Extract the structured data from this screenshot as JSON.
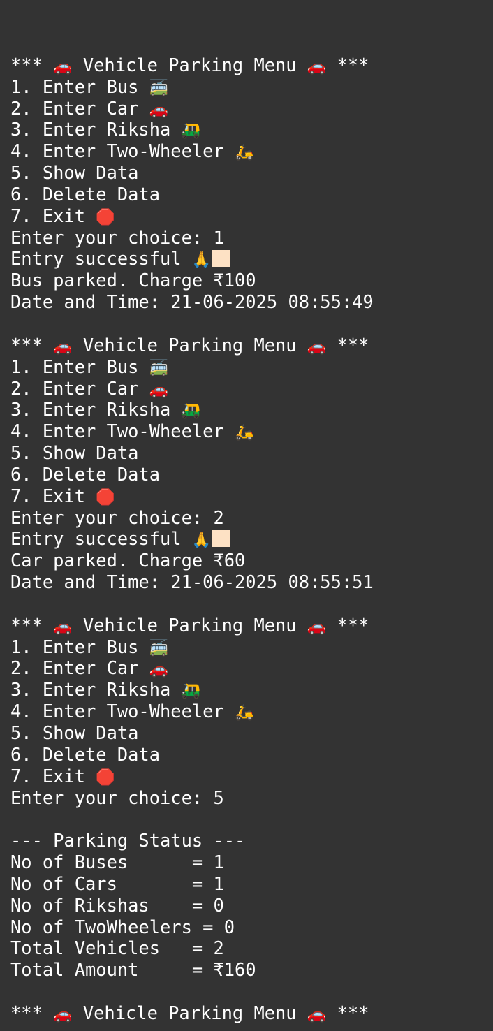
{
  "terminal": {
    "blocks": [
      {
        "menu": {
          "title_left": "*** ",
          "title_text": "Vehicle Parking Menu",
          "title_right": " ***",
          "items": [
            {
              "label": "1. Enter Bus",
              "icon": "🚎"
            },
            {
              "label": "2. Enter Car",
              "icon": "🚗"
            },
            {
              "label": "3. Enter Riksha",
              "icon": "🛺"
            },
            {
              "label": "4. Enter Two-Wheeler",
              "icon": "🛵"
            },
            {
              "label": "5. Show Data",
              "icon": ""
            },
            {
              "label": "6. Delete Data",
              "icon": ""
            },
            {
              "label": "7. Exit",
              "icon": "🛑"
            }
          ]
        },
        "prompt": "Enter your choice: 1",
        "entry_msg": "Entry successful",
        "entry_icon": "🙏",
        "parked_msg": "Bus parked. Charge ₹100",
        "datetime": "Date and Time: 21-06-2025 08:55:49"
      },
      {
        "menu": {
          "title_left": "*** ",
          "title_text": "Vehicle Parking Menu",
          "title_right": " ***",
          "items": [
            {
              "label": "1. Enter Bus",
              "icon": "🚎"
            },
            {
              "label": "2. Enter Car",
              "icon": "🚗"
            },
            {
              "label": "3. Enter Riksha",
              "icon": "🛺"
            },
            {
              "label": "4. Enter Two-Wheeler",
              "icon": "🛵"
            },
            {
              "label": "5. Show Data",
              "icon": ""
            },
            {
              "label": "6. Delete Data",
              "icon": ""
            },
            {
              "label": "7. Exit",
              "icon": "🛑"
            }
          ]
        },
        "prompt": "Enter your choice: 2",
        "entry_msg": "Entry successful",
        "entry_icon": "🙏",
        "parked_msg": "Car parked. Charge ₹60",
        "datetime": "Date and Time: 21-06-2025 08:55:51"
      },
      {
        "menu": {
          "title_left": "*** ",
          "title_text": "Vehicle Parking Menu",
          "title_right": " ***",
          "items": [
            {
              "label": "1. Enter Bus",
              "icon": "🚎"
            },
            {
              "label": "2. Enter Car",
              "icon": "🚗"
            },
            {
              "label": "3. Enter Riksha",
              "icon": "🛺"
            },
            {
              "label": "4. Enter Two-Wheeler",
              "icon": "🛵"
            },
            {
              "label": "5. Show Data",
              "icon": ""
            },
            {
              "label": "6. Delete Data",
              "icon": ""
            },
            {
              "label": "7. Exit",
              "icon": "🛑"
            }
          ]
        },
        "prompt": "Enter your choice: 5"
      }
    ],
    "status": {
      "header": "--- Parking Status ---",
      "rows": [
        "No of Buses      = 1",
        "No of Cars       = 1",
        "No of Rikshas    = 0",
        "No of TwoWheelers = 0",
        "Total Vehicles   = 2",
        "Total Amount     = ₹160"
      ]
    },
    "final_menu": {
      "title_left": "*** ",
      "title_text": "Vehicle Parking Menu",
      "title_right": " ***"
    },
    "car_icon": "🚗"
  }
}
